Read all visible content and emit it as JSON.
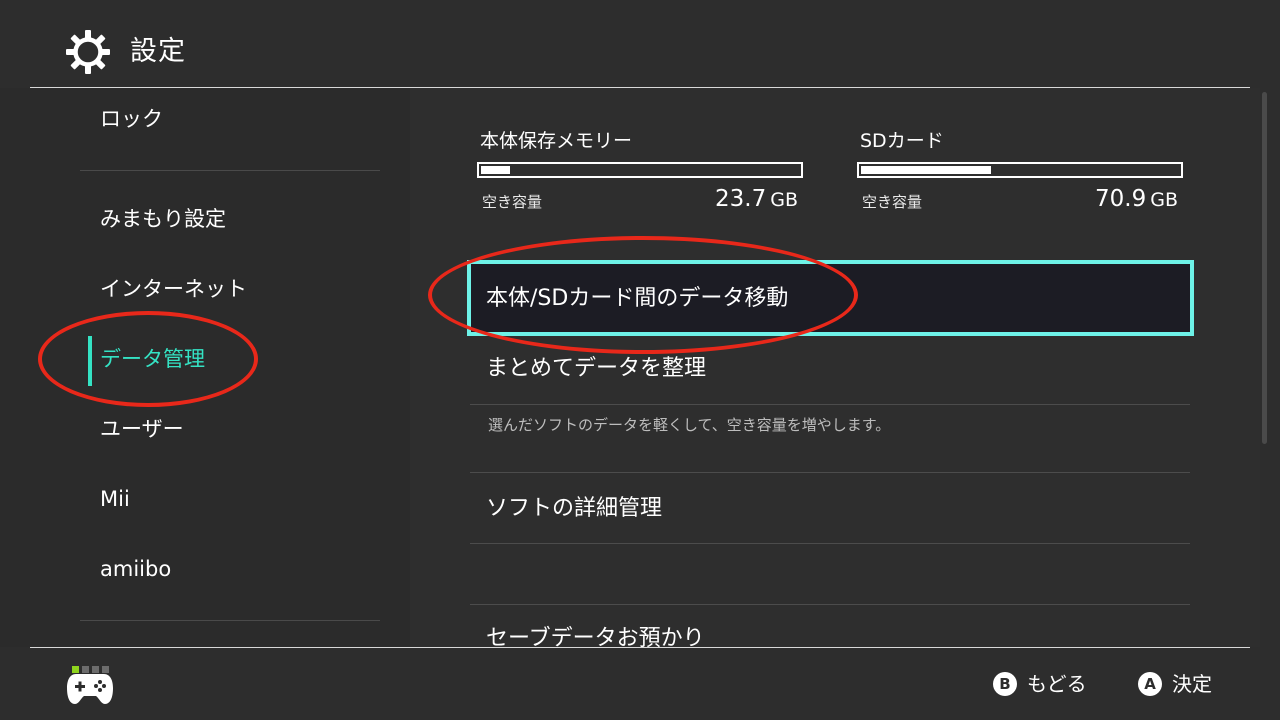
{
  "header": {
    "title": "設定",
    "icon": "gear-icon"
  },
  "sidebar": {
    "items": [
      {
        "label": "ロック"
      },
      {
        "label": "みまもり設定"
      },
      {
        "label": "インターネット"
      },
      {
        "label": "データ管理",
        "active": true
      },
      {
        "label": "ユーザー"
      },
      {
        "label": "Mii"
      },
      {
        "label": "amiibo"
      }
    ]
  },
  "storage": {
    "system": {
      "label": "本体保存メモリー",
      "free_label": "空き容量",
      "free_value": "23.7",
      "unit": "GB",
      "used_fraction": 0.09
    },
    "sd": {
      "label": "SDカード",
      "free_label": "空き容量",
      "free_value": "70.9",
      "unit": "GB",
      "used_fraction": 0.41
    }
  },
  "menu": {
    "items": [
      {
        "label": "本体/SDカード間のデータ移動",
        "selected": true
      },
      {
        "label": "まとめてデータを整理",
        "description": "選んだソフトのデータを軽くして、空き容量を増やします。"
      },
      {
        "label": "ソフトの詳細管理"
      },
      {
        "label": "セーブデータお預かり"
      }
    ]
  },
  "footer": {
    "back": {
      "button": "B",
      "label": "もどる"
    },
    "confirm": {
      "button": "A",
      "label": "決定"
    }
  },
  "colors": {
    "background": "#2d2d2d",
    "accent": "#34e3c4",
    "selection_border": "#6ef2e8",
    "annotation": "#e8281a",
    "page_dot_active": "#8fd41e"
  }
}
